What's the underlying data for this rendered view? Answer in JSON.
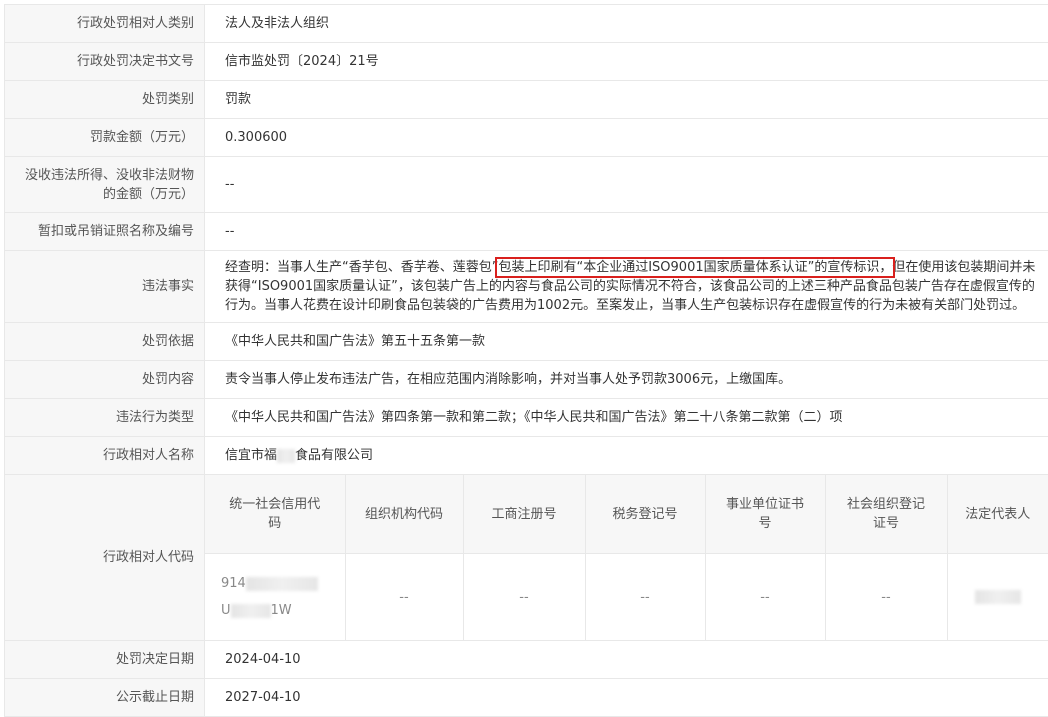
{
  "rows": [
    {
      "label": "行政处罚相对人类别",
      "value": "法人及非法人组织"
    },
    {
      "label": "行政处罚决定书文号",
      "value": "信市监处罚〔2024〕21号"
    },
    {
      "label": "处罚类别",
      "value": "罚款"
    },
    {
      "label": "罚款金额（万元）",
      "value": "0.300600"
    },
    {
      "label": "没收违法所得、没收非法财物的金额（万元）",
      "value": "--"
    },
    {
      "label": "暂扣或吊销证照名称及编号",
      "value": "--"
    }
  ],
  "violation": {
    "label": "违法事实",
    "pre": "经查明：当事人生产“香芋包、香芋卷、莲蓉包”",
    "highlight": "包装上印刷有“本企业通过ISO9001国家质量体系认证”的宣传标识，",
    "post": "但在使用该包装期间并未获得“ISO9001国家质量认证”，该包装广告上的内容与食品公司的实际情况不符合，该食品公司的上述三种产品食品包装广告存在虚假宣传的行为。当事人花费在设计印刷食品包装袋的广告费用为1002元。至案发止，当事人生产包装标识存在虚假宣传的行为未被有关部门处罚过。"
  },
  "rows2": [
    {
      "label": "处罚依据",
      "value": "《中华人民共和国广告法》第五十五条第一款"
    },
    {
      "label": "处罚内容",
      "value": "责令当事人停止发布违法广告，在相应范围内消除影响，并对当事人处予罚款3006元，上缴国库。"
    },
    {
      "label": "违法行为类型",
      "value": "《中华人民共和国广告法》第四条第一款和第二款；《中华人民共和国广告法》第二十八条第二款第（二）项"
    }
  ],
  "party_name": {
    "label": "行政相对人名称",
    "pre": "信宜市福",
    "post": "食品有限公司"
  },
  "party_code": {
    "label": "行政相对人代码",
    "headers": [
      "统一社会信用代码",
      "组织机构代码",
      "工商注册号",
      "税务登记号",
      "事业单位证书号",
      "社会组织登记证号",
      "法定代表人"
    ],
    "credit_code_line1": "914",
    "credit_code_line2_pre": "U",
    "credit_code_line2_post": "1W",
    "empty": [
      "--",
      "--",
      "--",
      "--",
      "--"
    ]
  },
  "dates": [
    {
      "label": "处罚决定日期",
      "value": "2024-04-10"
    },
    {
      "label": "公示截止日期",
      "value": "2027-04-10"
    }
  ],
  "colors": {
    "highlight_border": "#d9201d",
    "label_bg": "#f7f7f7",
    "border": "#e8e8e8"
  }
}
